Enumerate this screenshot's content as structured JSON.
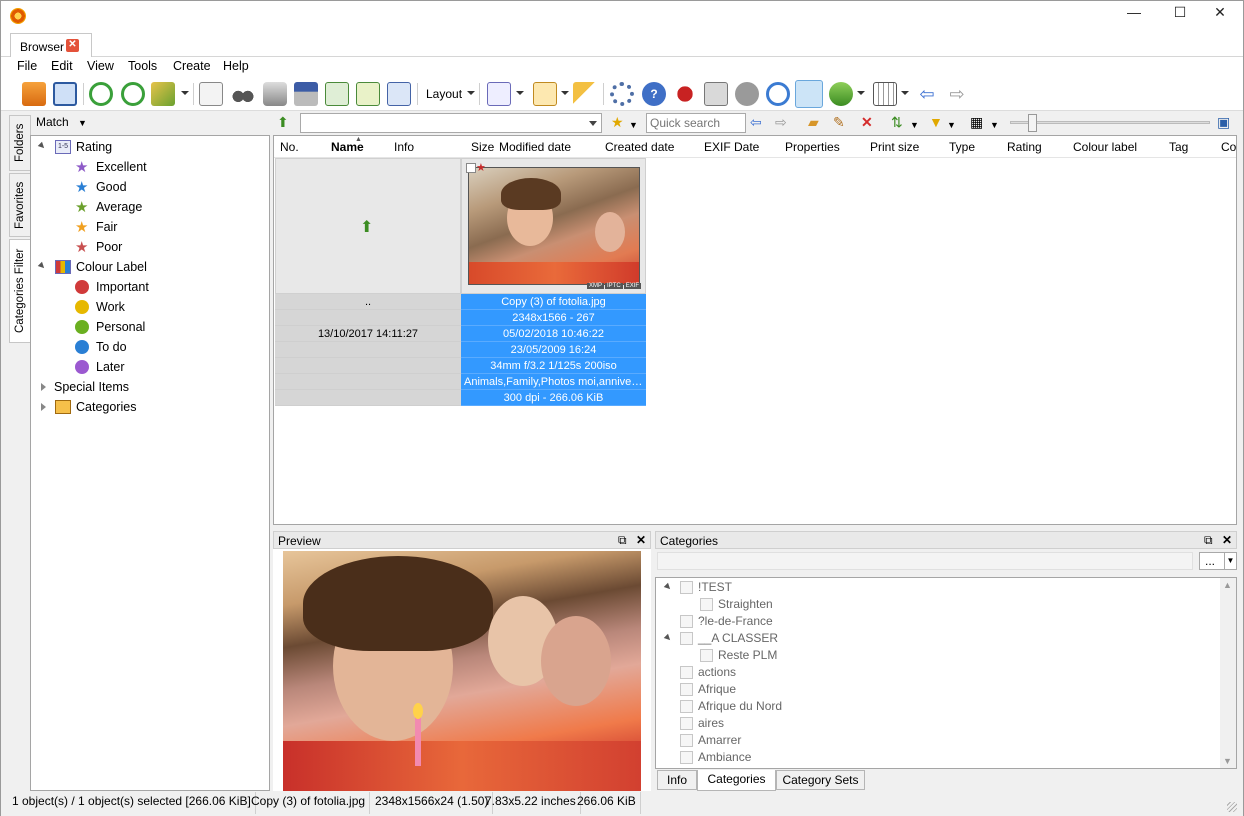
{
  "window": {
    "tab_label": "Browser",
    "minimize": "—",
    "maximize": "☐",
    "close": "✕"
  },
  "menu": [
    "File",
    "Edit",
    "View",
    "Tools",
    "Create",
    "Help"
  ],
  "toolbar": {
    "layout_label": "Layout"
  },
  "side_tabs": [
    "Folders",
    "Favorites",
    "Categories Filter"
  ],
  "left_panel": {
    "match_label": "Match",
    "tree": {
      "rating": "Rating",
      "rating_items": [
        "Excellent",
        "Good",
        "Average",
        "Fair",
        "Poor"
      ],
      "colour_label": "Colour Label",
      "colour_items": [
        "Important",
        "Work",
        "Personal",
        "To do",
        "Later"
      ],
      "special_items": "Special Items",
      "categories": "Categories"
    },
    "colors": {
      "excellent": "#8e5bc8",
      "good": "#2a7fd4",
      "average": "#6ba02c",
      "fair": "#f0a020",
      "poor": "#c85050",
      "important": "#d03a3a",
      "work": "#e6b800",
      "personal": "#6aaf20",
      "todo": "#2a7fd4",
      "later": "#9b59d0"
    }
  },
  "filter_bar": {
    "quick_search_placeholder": "Quick search"
  },
  "columns": [
    "No.",
    "Name",
    "Info",
    "Size",
    "Modified date",
    "Created date",
    "EXIF Date",
    "Properties",
    "Print size",
    "Type",
    "Rating",
    "Colour label",
    "Tag",
    "Co"
  ],
  "parent_row": {
    "name": "..",
    "date": "13/10/2017 14:11:27"
  },
  "file": {
    "badges": [
      "XMP",
      "IPTC",
      "EXIF"
    ],
    "lines": [
      "Copy (3) of fotolia.jpg",
      "2348x1566 - 267",
      "05/02/2018 10:46:22",
      "23/05/2009 16:24",
      "34mm f/3.2 1/125s 200iso",
      "Animals,Family,Photos moi,anniver…",
      "300 dpi - 266.06 KiB"
    ]
  },
  "preview": {
    "title": "Preview"
  },
  "categories_panel": {
    "title": "Categories",
    "more_button": "...",
    "items": [
      {
        "label": "!TEST",
        "level": 0,
        "expanded": true
      },
      {
        "label": "Straighten",
        "level": 1
      },
      {
        "label": "?le-de-France",
        "level": 0
      },
      {
        "label": "__A CLASSER",
        "level": 0,
        "expanded": true
      },
      {
        "label": "Reste PLM",
        "level": 1
      },
      {
        "label": "actions",
        "level": 0
      },
      {
        "label": "Afrique",
        "level": 0
      },
      {
        "label": "Afrique du Nord",
        "level": 0
      },
      {
        "label": "aires",
        "level": 0
      },
      {
        "label": "Amarrer",
        "level": 0
      },
      {
        "label": "Ambiance",
        "level": 0
      }
    ],
    "tabs": [
      "Info",
      "Categories",
      "Category Sets"
    ],
    "active_tab": "Categories"
  },
  "status": [
    "1 object(s) / 1 object(s) selected [266.06 KiB]",
    "Copy (3) of fotolia.jpg",
    "2348x1566x24 (1.50)",
    "7.83x5.22 inches",
    "266.06 KiB"
  ]
}
